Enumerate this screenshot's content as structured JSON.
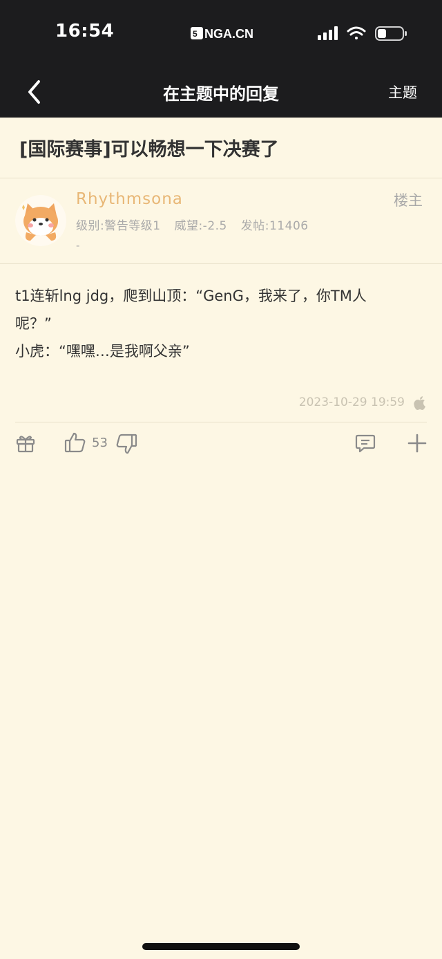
{
  "status_bar": {
    "time": "16:54",
    "carrier": "NGA.CN",
    "battery_level": 0.35
  },
  "nav": {
    "title": "在主题中的回复",
    "right_label": "主题",
    "background": "#1c1c1e"
  },
  "topic": {
    "title": "[国际赛事]可以畅想一下决赛了"
  },
  "post": {
    "author": {
      "name": "Rhythmsona",
      "level": "级别:警告等级1",
      "reputation": "威望:-2.5",
      "post_count": "发帖:11406",
      "signature": "-"
    },
    "floor_tag": "楼主",
    "body_lines": [
      "t1连斩lng jdg，爬到山顶：“GenG，我来了，你TM人",
      "呢？”",
      "小虎：“嘿嘿…是我啊父亲”"
    ],
    "timestamp": "2023-10-29 19:59",
    "platform_icon": "apple-icon",
    "like_count": "53"
  },
  "colors": {
    "background": "#fdf7e4",
    "username": "#e8b776",
    "text": "#333333",
    "muted": "#aaaaaa"
  }
}
